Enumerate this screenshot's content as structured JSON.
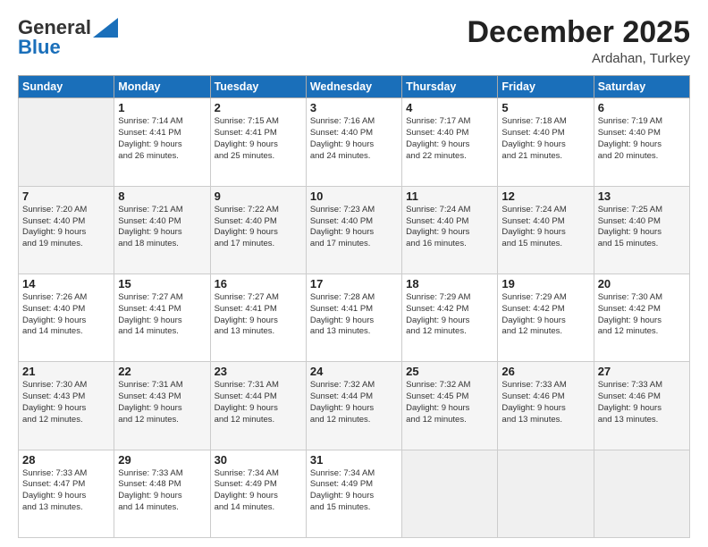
{
  "header": {
    "logo_general": "General",
    "logo_blue": "Blue",
    "month": "December 2025",
    "location": "Ardahan, Turkey"
  },
  "weekdays": [
    "Sunday",
    "Monday",
    "Tuesday",
    "Wednesday",
    "Thursday",
    "Friday",
    "Saturday"
  ],
  "weeks": [
    [
      {
        "day": "",
        "info": ""
      },
      {
        "day": "1",
        "info": "Sunrise: 7:14 AM\nSunset: 4:41 PM\nDaylight: 9 hours\nand 26 minutes."
      },
      {
        "day": "2",
        "info": "Sunrise: 7:15 AM\nSunset: 4:41 PM\nDaylight: 9 hours\nand 25 minutes."
      },
      {
        "day": "3",
        "info": "Sunrise: 7:16 AM\nSunset: 4:40 PM\nDaylight: 9 hours\nand 24 minutes."
      },
      {
        "day": "4",
        "info": "Sunrise: 7:17 AM\nSunset: 4:40 PM\nDaylight: 9 hours\nand 22 minutes."
      },
      {
        "day": "5",
        "info": "Sunrise: 7:18 AM\nSunset: 4:40 PM\nDaylight: 9 hours\nand 21 minutes."
      },
      {
        "day": "6",
        "info": "Sunrise: 7:19 AM\nSunset: 4:40 PM\nDaylight: 9 hours\nand 20 minutes."
      }
    ],
    [
      {
        "day": "7",
        "info": "Sunrise: 7:20 AM\nSunset: 4:40 PM\nDaylight: 9 hours\nand 19 minutes."
      },
      {
        "day": "8",
        "info": "Sunrise: 7:21 AM\nSunset: 4:40 PM\nDaylight: 9 hours\nand 18 minutes."
      },
      {
        "day": "9",
        "info": "Sunrise: 7:22 AM\nSunset: 4:40 PM\nDaylight: 9 hours\nand 17 minutes."
      },
      {
        "day": "10",
        "info": "Sunrise: 7:23 AM\nSunset: 4:40 PM\nDaylight: 9 hours\nand 17 minutes."
      },
      {
        "day": "11",
        "info": "Sunrise: 7:24 AM\nSunset: 4:40 PM\nDaylight: 9 hours\nand 16 minutes."
      },
      {
        "day": "12",
        "info": "Sunrise: 7:24 AM\nSunset: 4:40 PM\nDaylight: 9 hours\nand 15 minutes."
      },
      {
        "day": "13",
        "info": "Sunrise: 7:25 AM\nSunset: 4:40 PM\nDaylight: 9 hours\nand 15 minutes."
      }
    ],
    [
      {
        "day": "14",
        "info": "Sunrise: 7:26 AM\nSunset: 4:40 PM\nDaylight: 9 hours\nand 14 minutes."
      },
      {
        "day": "15",
        "info": "Sunrise: 7:27 AM\nSunset: 4:41 PM\nDaylight: 9 hours\nand 14 minutes."
      },
      {
        "day": "16",
        "info": "Sunrise: 7:27 AM\nSunset: 4:41 PM\nDaylight: 9 hours\nand 13 minutes."
      },
      {
        "day": "17",
        "info": "Sunrise: 7:28 AM\nSunset: 4:41 PM\nDaylight: 9 hours\nand 13 minutes."
      },
      {
        "day": "18",
        "info": "Sunrise: 7:29 AM\nSunset: 4:42 PM\nDaylight: 9 hours\nand 12 minutes."
      },
      {
        "day": "19",
        "info": "Sunrise: 7:29 AM\nSunset: 4:42 PM\nDaylight: 9 hours\nand 12 minutes."
      },
      {
        "day": "20",
        "info": "Sunrise: 7:30 AM\nSunset: 4:42 PM\nDaylight: 9 hours\nand 12 minutes."
      }
    ],
    [
      {
        "day": "21",
        "info": "Sunrise: 7:30 AM\nSunset: 4:43 PM\nDaylight: 9 hours\nand 12 minutes."
      },
      {
        "day": "22",
        "info": "Sunrise: 7:31 AM\nSunset: 4:43 PM\nDaylight: 9 hours\nand 12 minutes."
      },
      {
        "day": "23",
        "info": "Sunrise: 7:31 AM\nSunset: 4:44 PM\nDaylight: 9 hours\nand 12 minutes."
      },
      {
        "day": "24",
        "info": "Sunrise: 7:32 AM\nSunset: 4:44 PM\nDaylight: 9 hours\nand 12 minutes."
      },
      {
        "day": "25",
        "info": "Sunrise: 7:32 AM\nSunset: 4:45 PM\nDaylight: 9 hours\nand 12 minutes."
      },
      {
        "day": "26",
        "info": "Sunrise: 7:33 AM\nSunset: 4:46 PM\nDaylight: 9 hours\nand 13 minutes."
      },
      {
        "day": "27",
        "info": "Sunrise: 7:33 AM\nSunset: 4:46 PM\nDaylight: 9 hours\nand 13 minutes."
      }
    ],
    [
      {
        "day": "28",
        "info": "Sunrise: 7:33 AM\nSunset: 4:47 PM\nDaylight: 9 hours\nand 13 minutes."
      },
      {
        "day": "29",
        "info": "Sunrise: 7:33 AM\nSunset: 4:48 PM\nDaylight: 9 hours\nand 14 minutes."
      },
      {
        "day": "30",
        "info": "Sunrise: 7:34 AM\nSunset: 4:49 PM\nDaylight: 9 hours\nand 14 minutes."
      },
      {
        "day": "31",
        "info": "Sunrise: 7:34 AM\nSunset: 4:49 PM\nDaylight: 9 hours\nand 15 minutes."
      },
      {
        "day": "",
        "info": ""
      },
      {
        "day": "",
        "info": ""
      },
      {
        "day": "",
        "info": ""
      }
    ]
  ]
}
